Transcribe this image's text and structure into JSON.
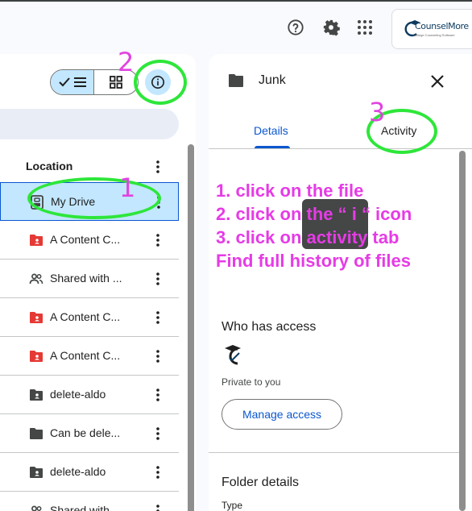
{
  "header": {
    "icons": [
      "help-icon",
      "settings-icon",
      "apps-icon"
    ],
    "logo_text": "CounselMore",
    "logo_subtext": "College Counseling Software"
  },
  "left_panel": {
    "column_header": "Location",
    "rows": [
      {
        "label": "My Drive",
        "icon": "my-drive-icon",
        "selected": true
      },
      {
        "label": "A Content C...",
        "icon": "shared-folder-red-icon"
      },
      {
        "label": "Shared with ...",
        "icon": "people-icon"
      },
      {
        "label": "A Content C...",
        "icon": "shared-folder-red-icon"
      },
      {
        "label": "A Content C...",
        "icon": "shared-folder-red-icon"
      },
      {
        "label": "delete-aldo",
        "icon": "shared-folder-icon"
      },
      {
        "label": "Can be dele...",
        "icon": "folder-icon"
      },
      {
        "label": "delete-aldo",
        "icon": "shared-folder-icon"
      },
      {
        "label": "Shared with ...",
        "icon": "people-icon"
      }
    ]
  },
  "details_panel": {
    "title": "Junk",
    "tabs": {
      "details": "Details",
      "activity": "Activity"
    },
    "access_heading": "Who has access",
    "access_text": "Private to you",
    "manage_button": "Manage access",
    "folder_details_heading": "Folder details",
    "type_label": "Type"
  },
  "annotations": {
    "numbers": [
      "2",
      "3",
      "1"
    ],
    "instructions": [
      "1. click on the file",
      "2. click on the  “ i “ icon",
      "3. click on activity tab",
      "Find full history of files"
    ]
  },
  "colors": {
    "accent_blue": "#0b57d0",
    "selected_bg": "#c2e7ff",
    "annotation_pink": "#e63be6",
    "annotation_green": "#2ee63a",
    "folder_red": "#e53935"
  }
}
